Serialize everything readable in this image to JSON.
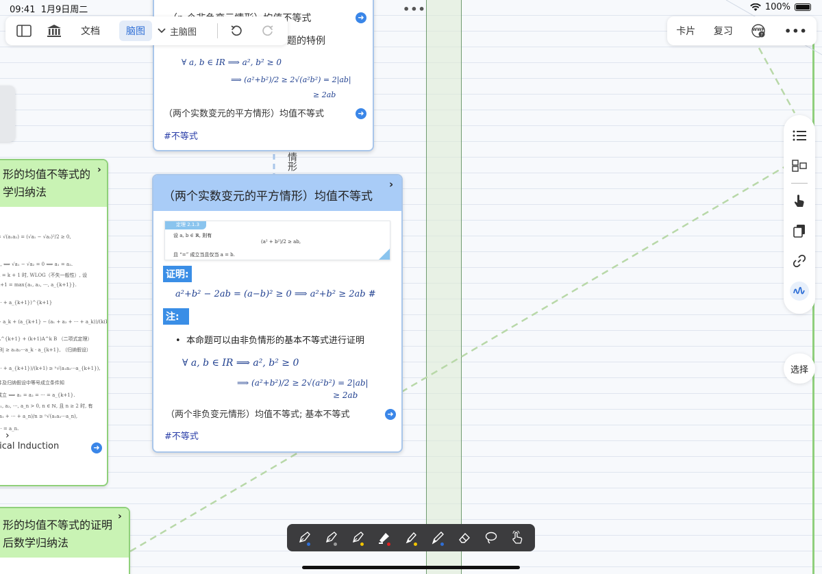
{
  "status_bar": {
    "time": "09:41",
    "date": "1月9日周二",
    "battery": "100%"
  },
  "toolbar_left": {
    "doc_label": "文档",
    "mindmap_label": "脑图",
    "main_mindmap_label": "主脑图"
  },
  "toolbar_right": {
    "card_label": "卡片",
    "review_label": "复习",
    "wwp_label": "WWP"
  },
  "side_palette": {
    "choose_label": "选择"
  },
  "top_card": {
    "title_partial": "（n 个非负变元情形）均值不等式",
    "special_case": "题的特例",
    "link_text": "（两个实数变元的平方情形）均值不等式",
    "tag": "#不等式",
    "formula_line1": "∀ a, b ∈ IR ⟹ a², b² ≥ 0",
    "formula_line2": "⟹ (a²+b²)/2 ≥ 2√(a²b²) = 2|ab|",
    "formula_line3": "≥ 2ab"
  },
  "main_card": {
    "title": "（两个实数变元的平方情形）均值不等式",
    "thumb_tag": "定理 2.1.3",
    "thumb_text1": "设 a, b ∈ ℝ, 则有",
    "thumb_formula": "(a² + b²)/2 ≥ ab,",
    "thumb_text2": "且 “=” 成立当且仅当 a = b.",
    "proof_label": "证明:",
    "proof_formula": "a²+b² − 2ab = (a−b)² ≥ 0 ⟹ a²+b² ≥ 2ab #",
    "note_label": "注:",
    "bullet": "本命题可以由非负情形的基本不等式进行证明",
    "note_formula1": "∀ a, b ∈ IR ⟹ a², b² ≥ 0",
    "note_formula2": "⟹ (a²+b²)/2 ≥ 2√(a²b²) = 2|ab|",
    "note_formula3": "≥ 2ab",
    "link_text": "（两个非负变元情形）均值不等式; 基本不等式",
    "tag": "#不等式"
  },
  "connector_text": "情形",
  "left_card": {
    "title_line1": "形的均值不等式的",
    "title_line2": "学归纳法",
    "link_text": "tical Induction",
    "mini_lines": [
      "= √(a₁a₂) = (√a₁ − √a₂)²/2 ≥ 0,",
      "2, ⟺ √a₁ − √a₂ = 0 ⟺ a₁ = a₂.",
      "n = k + 1 时, WLOG（不失一般性）, 设",
      "k+1 = max{a₁, a₂, ···, a_{k+1}}.",
      "··· + a_{k+1})^{k+1}",
      "1",
      "+ a_k + (a_{k+1} − (a₁ + a₂ + ··· + a_k))/(k(k+1))]^{k+1}",
      "A^{k+1} + (k+1)A^k B （二项式定理）",
      "|B| ≥ a₁a₂···a_k · a_{k+1}, （归纳假设）",
      "··· + a_{k+1})/(k+1) ≥ ⁿ√(a₁a₂···a_{k+1}),",
      "件及归纳假设中等号成立条件知",
      "成立 ⟺ a₁ = a₂ = ··· = a_{k+1}.",
      "a₁, a₂, ···, a_n > 0, n ∈ ℕ, 且 n ≥ 2 时, 有",
      "(a₁ + ··· + a_n)/n ≥ ⁿ√(a₁a₂···a_n),",
      "··· = a_n."
    ]
  },
  "bottom_left_card": {
    "title_line1": "形的均值不等式的证明",
    "title_line2": "后数学归纳法"
  },
  "colors": {
    "accent_blue": "#3a86e8",
    "card_header_blue": "#a9ccf7",
    "green_header": "#c9f3b4",
    "toolbar_dark": "#3c3c3e"
  }
}
